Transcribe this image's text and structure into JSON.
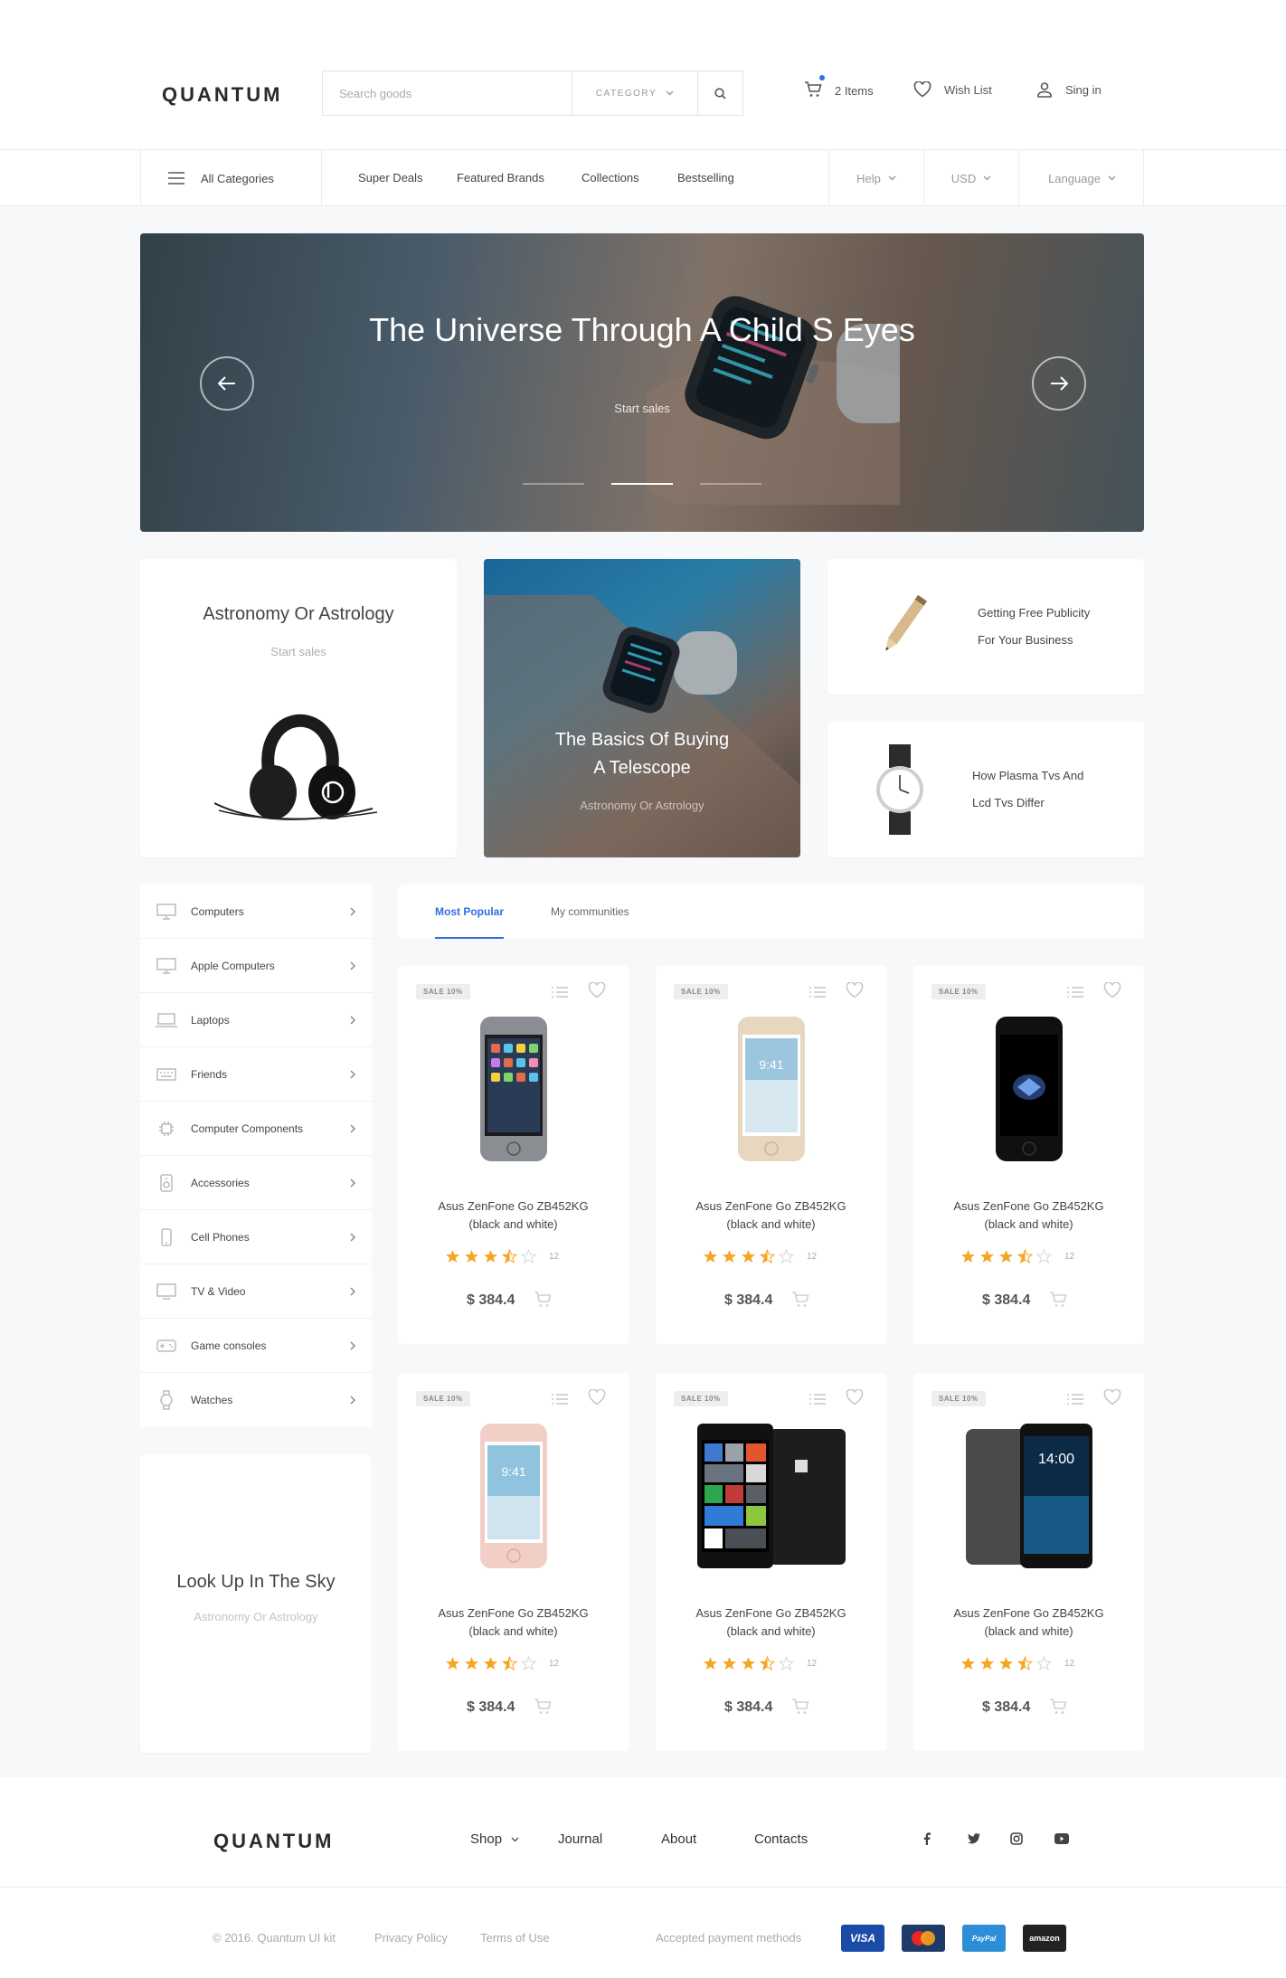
{
  "header": {
    "logo": "QUANTUM",
    "search_placeholder": "Search goods",
    "category_label": "CATEGORY",
    "cart_label": "2 Items",
    "wishlist_label": "Wish List",
    "signin_label": "Sing in"
  },
  "nav": {
    "all_categories": "All Categories",
    "links": [
      "Super Deals",
      "Featured Brands",
      "Collections",
      "Bestselling"
    ],
    "help": "Help",
    "currency": "USD",
    "language": "Language"
  },
  "hero": {
    "title": "The Universe Through A Child S Eyes",
    "subtitle": "Start sales",
    "slide_count": 3,
    "active_slide": 2
  },
  "promos": {
    "promo1": {
      "title": "Astronomy Or Astrology",
      "subtitle": "Start sales"
    },
    "promo2": {
      "title_line1": "The Basics Of Buying",
      "title_line2": "A Telescope",
      "subtitle": "Astronomy Or Astrology"
    },
    "promo3": {
      "line1": "Getting Free Publicity",
      "line2": "For Your Business"
    },
    "promo4": {
      "line1": "How Plasma Tvs And",
      "line2": "Lcd Tvs Differ"
    }
  },
  "sidebar": {
    "items": [
      {
        "label": "Computers",
        "icon": "monitor-icon"
      },
      {
        "label": "Apple Computers",
        "icon": "monitor-icon"
      },
      {
        "label": "Laptops",
        "icon": "laptop-icon"
      },
      {
        "label": "Friends",
        "icon": "keyboard-icon"
      },
      {
        "label": "Computer Components",
        "icon": "cpu-icon"
      },
      {
        "label": "Accessories",
        "icon": "speaker-icon"
      },
      {
        "label": "Cell Phones",
        "icon": "phone-icon"
      },
      {
        "label": "TV & Video",
        "icon": "tv-icon"
      },
      {
        "label": "Game consoles",
        "icon": "gamepad-icon"
      },
      {
        "label": "Watches",
        "icon": "watch-icon"
      }
    ],
    "promo": {
      "title": "Look Up In The Sky",
      "subtitle": "Astronomy Or Astrology"
    }
  },
  "tabs": [
    {
      "label": "Most Popular",
      "active": true
    },
    {
      "label": "My communities",
      "active": false
    }
  ],
  "products": [
    {
      "badge": "SALE 10%",
      "name_line1": "Asus ZenFone Go ZB452KG",
      "name_line2": "(black and white)",
      "rating": 3.5,
      "reviews": "12",
      "price": "$ 384.4",
      "image": "phone-space-gray"
    },
    {
      "badge": "SALE 10%",
      "name_line1": "Asus ZenFone Go ZB452KG",
      "name_line2": "(black and white)",
      "rating": 3.5,
      "reviews": "12",
      "price": "$ 384.4",
      "image": "phone-gold"
    },
    {
      "badge": "SALE 10%",
      "name_line1": "Asus ZenFone Go ZB452KG",
      "name_line2": "(black and white)",
      "rating": 3.5,
      "reviews": "12",
      "price": "$ 384.4",
      "image": "phone-jet-black"
    },
    {
      "badge": "SALE 10%",
      "name_line1": "Asus ZenFone Go ZB452KG",
      "name_line2": "(black and white)",
      "rating": 3.5,
      "reviews": "12",
      "price": "$ 384.4",
      "image": "phone-rose-gold"
    },
    {
      "badge": "SALE 10%",
      "name_line1": "Asus ZenFone Go ZB452KG",
      "name_line2": "(black and white)",
      "rating": 3.5,
      "reviews": "12",
      "price": "$ 384.4",
      "image": "phone-lumia"
    },
    {
      "badge": "SALE 10%",
      "name_line1": "Asus ZenFone Go ZB452KG",
      "name_line2": "(black and white)",
      "rating": 3.5,
      "reviews": "12",
      "price": "$ 384.4",
      "image": "phone-mi"
    }
  ],
  "footer": {
    "logo": "QUANTUM",
    "links": [
      "Shop",
      "Journal",
      "About",
      "Contacts"
    ],
    "copyright": "© 2016. Quantum UI kit",
    "privacy": "Privacy Policy",
    "terms": "Terms of Use",
    "payment_label": "Accepted payment methods",
    "payments": [
      "VISA",
      "MasterCard",
      "PayPal",
      "amazon"
    ],
    "social": [
      "facebook-icon",
      "twitter-icon",
      "instagram-icon",
      "youtube-icon"
    ]
  },
  "colors": {
    "accent": "#2f6fe0",
    "star": "#f5a623",
    "text": "#333333"
  }
}
